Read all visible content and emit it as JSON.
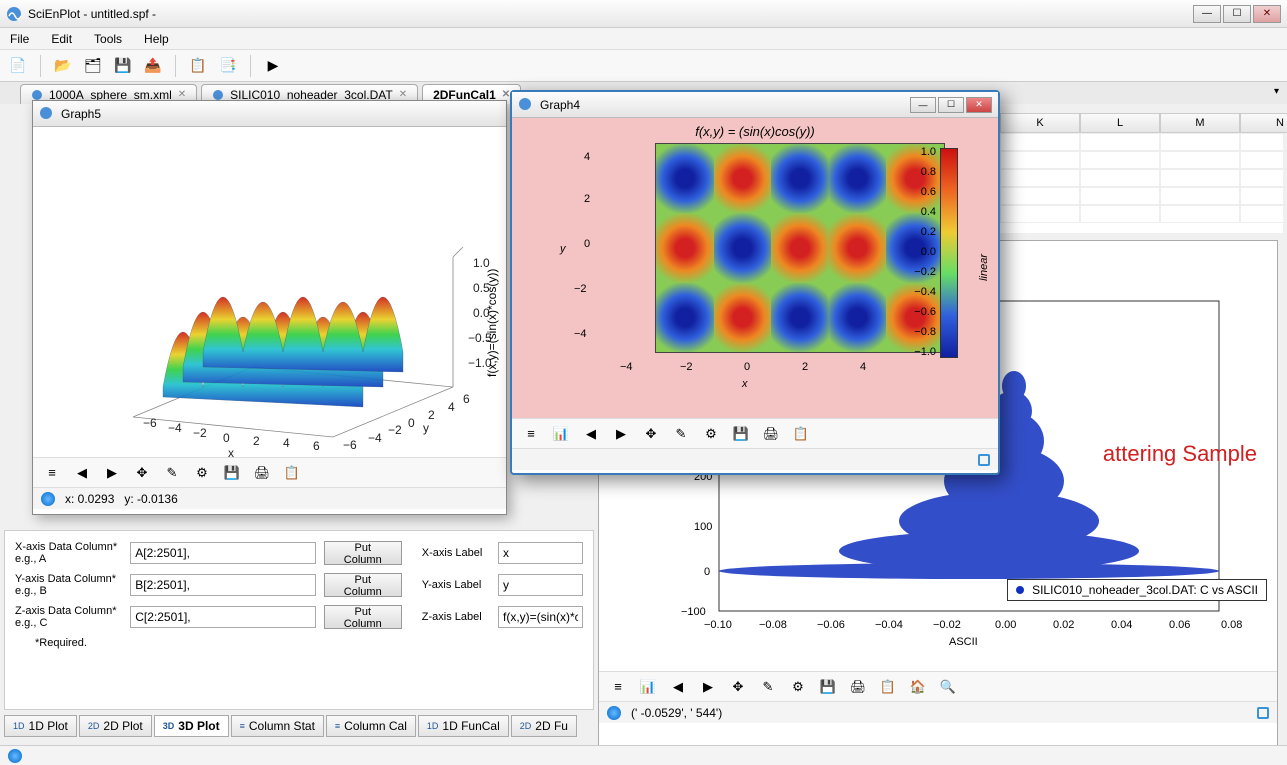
{
  "app": {
    "title": "SciEnPlot    - untitled.spf -"
  },
  "menu": {
    "file": "File",
    "edit": "Edit",
    "tools": "Tools",
    "help": "Help"
  },
  "docTabs": [
    {
      "label": "1000A_sphere_sm.xml",
      "active": false
    },
    {
      "label": "SILIC010_noheader_3col.DAT",
      "active": false
    },
    {
      "label": "2DFunCal1",
      "active": true
    }
  ],
  "sheet": {
    "cols": [
      "K",
      "L",
      "M",
      "N"
    ]
  },
  "graph5": {
    "title": "Graph5",
    "zlabel": "f(x,y)=(sin(x)*cos(y))",
    "xlabel": "x",
    "ylabel": "y",
    "xticks": [
      "−6",
      "−4",
      "−2",
      "0",
      "2",
      "4",
      "6"
    ],
    "yticks": [
      "−6",
      "−4",
      "−2",
      "0",
      "2",
      "4",
      "6"
    ],
    "zticks": [
      "1.0",
      "0.5",
      "0.0",
      "−0.5",
      "−1.0"
    ],
    "status": {
      "x": "x:  0.0293",
      "y": "y:  -0.0136"
    }
  },
  "graph4": {
    "title": "Graph4",
    "ftitle": "f(x,y) = (sin(x)cos(y))",
    "xlabel": "x",
    "ylabel": "y",
    "cblabel": "linear",
    "xticks": [
      "−4",
      "−2",
      "0",
      "2",
      "4"
    ],
    "yticks": [
      "4",
      "2",
      "0",
      "−2",
      "−4"
    ],
    "cbticks": [
      "1.0",
      "0.8",
      "0.6",
      "0.4",
      "0.2",
      "0.0",
      "−0.2",
      "−0.4",
      "−0.6",
      "−0.8",
      "−1.0"
    ]
  },
  "scatter": {
    "titleFrag": "attering Sample",
    "xlabel": "ASCII",
    "legend": "SILIC010_noheader_3col.DAT: C vs ASCII",
    "xticks": [
      "−0.10",
      "−0.08",
      "−0.06",
      "−0.04",
      "−0.02",
      "0.00",
      "0.02",
      "0.04",
      "0.06",
      "0.08"
    ],
    "yticks": [
      "200",
      "100",
      "0",
      "−100"
    ],
    "status": "(' -0.0529',  '   544')"
  },
  "form": {
    "rows": [
      {
        "lbl": "X-axis Data Column*\ne.g., A",
        "val": "A[2:2501],",
        "btn": "Put Column",
        "lbl2": "X-axis Label",
        "val2": "x"
      },
      {
        "lbl": "Y-axis Data Column*\ne.g., B",
        "val": "B[2:2501],",
        "btn": "Put Column",
        "lbl2": "Y-axis Label",
        "val2": "y"
      },
      {
        "lbl": "Z-axis Data Column*\ne.g., C",
        "val": "C[2:2501],",
        "btn": "Put Column",
        "lbl2": "Z-axis Label",
        "val2": "f(x,y)=(sin(x)*c"
      }
    ],
    "req": "*Required."
  },
  "bottomTabs": [
    {
      "pre": "1D",
      "label": "1D Plot"
    },
    {
      "pre": "2D",
      "label": "2D Plot"
    },
    {
      "pre": "3D",
      "label": "3D Plot",
      "active": true
    },
    {
      "pre": "",
      "label": "Column Stat"
    },
    {
      "pre": "",
      "label": "Column Cal"
    },
    {
      "pre": "1D",
      "label": "1D FunCal"
    },
    {
      "pre": "2D",
      "label": "2D Fu"
    }
  ],
  "chart_data": [
    {
      "id": "graph5_surface",
      "type": "surface3d",
      "title": "f(x,y)=(sin(x)*cos(y))",
      "xlabel": "x",
      "ylabel": "y",
      "zlabel": "f(x,y)=(sin(x)*cos(y))",
      "xrange": [
        -6,
        6
      ],
      "yrange": [
        -6,
        6
      ],
      "zrange": [
        -1.0,
        1.0
      ],
      "formula": "sin(x)*cos(y)"
    },
    {
      "id": "graph4_heatmap",
      "type": "heatmap",
      "title": "f(x,y) = (sin(x)cos(y))",
      "xlabel": "x",
      "ylabel": "y",
      "xrange": [
        -5,
        5
      ],
      "yrange": [
        -5,
        5
      ],
      "colorbar": {
        "range": [
          -1.0,
          1.0
        ],
        "label": "linear"
      },
      "formula": "sin(x)*cos(y)"
    },
    {
      "id": "scatter_right",
      "type": "scatter",
      "title": "...attering Sample",
      "xlabel": "ASCII",
      "ylabel": "",
      "series": [
        {
          "name": "SILIC010_noheader_3col.DAT: C vs ASCII",
          "approx_points": "dense bell-shaped cluster centered near x=0.00, y peak ~250, baseline ~0"
        }
      ],
      "xlim": [
        -0.1,
        0.08
      ],
      "ylim": [
        -100,
        250
      ]
    }
  ]
}
